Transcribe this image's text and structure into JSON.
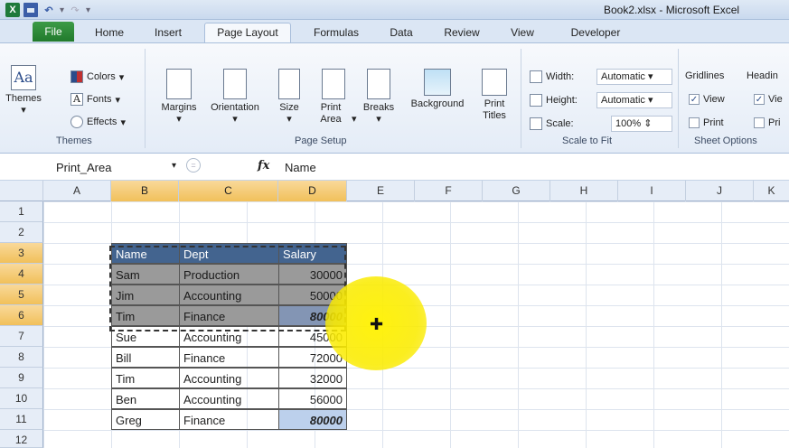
{
  "window": {
    "title": "Book2.xlsx - Microsoft Excel"
  },
  "tabs": [
    "File",
    "Home",
    "Insert",
    "Page Layout",
    "Formulas",
    "Data",
    "Review",
    "View",
    "Developer"
  ],
  "ribbon": {
    "themes": {
      "themes_label": "Themes",
      "colors": "Colors",
      "fonts": "Fonts",
      "effects": "Effects",
      "group": "Themes"
    },
    "page_setup": {
      "margins": "Margins",
      "orientation": "Orientation",
      "size": "Size",
      "print_area": "Print Area",
      "breaks": "Breaks",
      "background": "Background",
      "print_titles": "Print Titles",
      "group": "Page Setup"
    },
    "scale_to_fit": {
      "width_label": "Width:",
      "width_value": "Automatic",
      "height_label": "Height:",
      "height_value": "Automatic",
      "scale_label": "Scale:",
      "scale_value": "100%",
      "group": "Scale to Fit"
    },
    "sheet_options": {
      "gridlines": "Gridlines",
      "headings": "Headin",
      "view": "View",
      "view2": "Vie",
      "print": "Print",
      "print2": "Pri",
      "group": "Sheet Options"
    }
  },
  "formula_bar": {
    "name_box": "Print_Area",
    "fx": "fx",
    "content": "Name"
  },
  "columns": [
    "A",
    "B",
    "C",
    "D",
    "E",
    "F",
    "G",
    "H",
    "I",
    "J",
    "K"
  ],
  "rows": [
    "1",
    "2",
    "3",
    "4",
    "5",
    "6",
    "7",
    "8",
    "9",
    "10",
    "11",
    "12"
  ],
  "table": {
    "header": [
      "Name",
      "Dept",
      "Salary"
    ],
    "rows": [
      [
        "Sam",
        "Production",
        "30000"
      ],
      [
        "Jim",
        "Accounting",
        "50000"
      ],
      [
        "Tim",
        "Finance",
        "80000"
      ],
      [
        "Sue",
        "Accounting",
        "45000"
      ],
      [
        "Bill",
        "Finance",
        "72000"
      ],
      [
        "Tim",
        "Accounting",
        "32000"
      ],
      [
        "Ben",
        "Accounting",
        "56000"
      ],
      [
        "Greg",
        "Finance",
        "80000"
      ]
    ]
  }
}
